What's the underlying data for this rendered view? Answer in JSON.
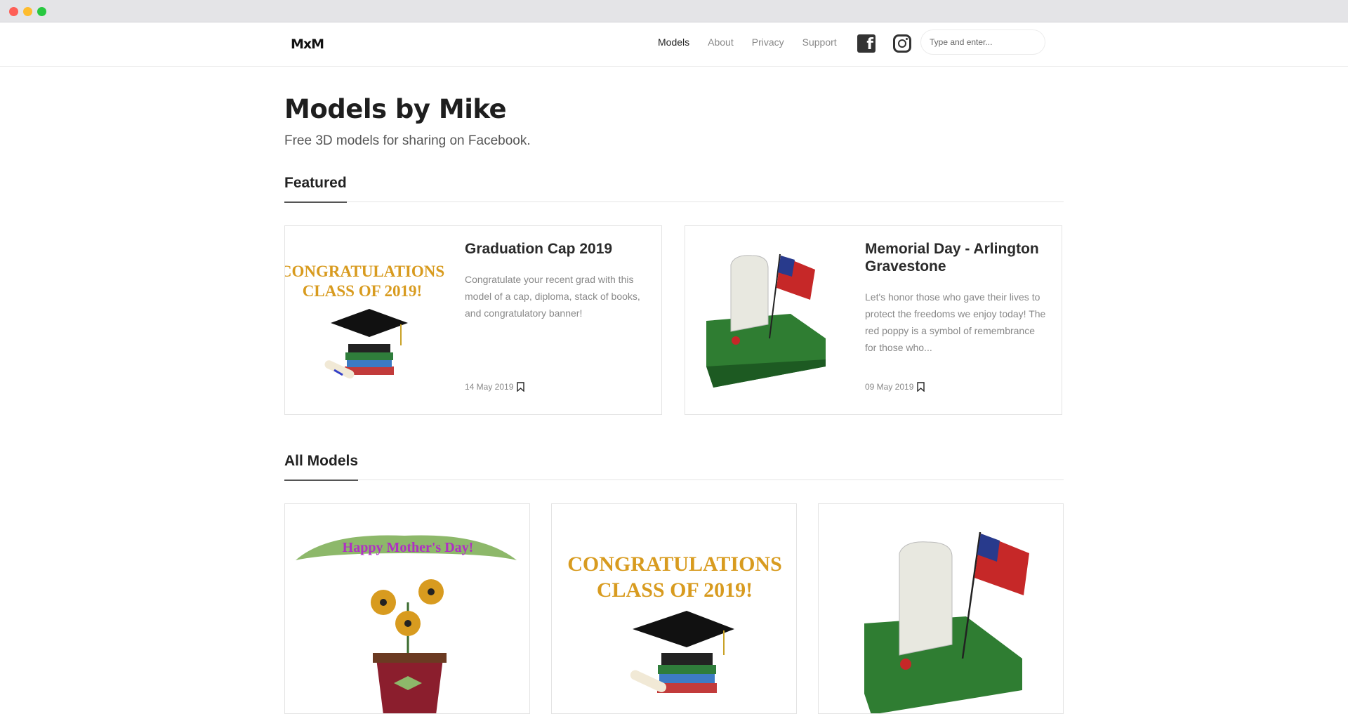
{
  "header": {
    "logo": "MxM",
    "nav": [
      "Models",
      "About",
      "Privacy",
      "Support"
    ],
    "search_placeholder": "Type and enter..."
  },
  "hero": {
    "title": "Models by Mike",
    "tagline": "Free 3D models for sharing on Facebook."
  },
  "featured": {
    "heading": "Featured",
    "cards": [
      {
        "title": "Graduation Cap 2019",
        "excerpt": "Congratulate your recent grad with this model of a cap, diploma, stack of books, and congratulatory banner!",
        "date": "14 May 2019"
      },
      {
        "title": "Memorial Day - Arlington Gravestone",
        "excerpt": "Let's honor those who gave their lives to protect the freedoms we enjoy today! The red poppy is a symbol of remembrance for those who...",
        "date": "09 May 2019"
      }
    ]
  },
  "all_models": {
    "heading": "All Models"
  },
  "artwork": {
    "congrats_line1": "CONGRATULATIONS",
    "congrats_line2": "CLASS OF 2019!",
    "mothers_day": "Happy Mother's Day!"
  },
  "colors": {
    "gold_text": "#d89b1f",
    "grass": "#2e7d32",
    "banner_green": "#8db86a",
    "mothers_day_text": "#b02fc4"
  }
}
